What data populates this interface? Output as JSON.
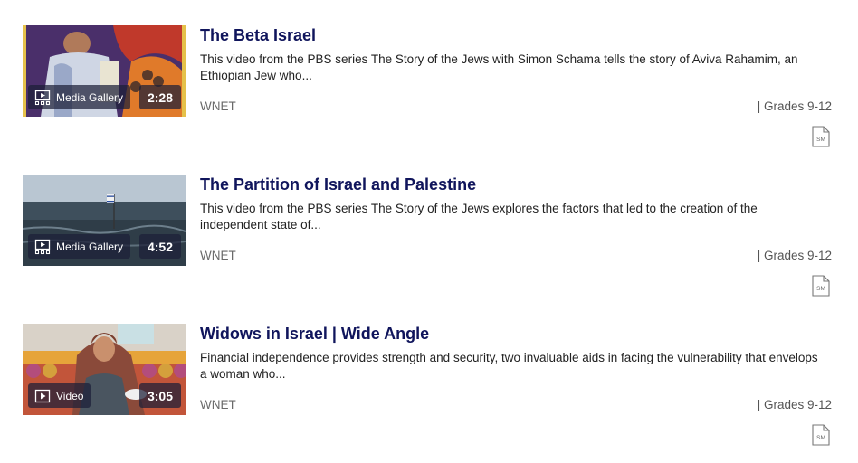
{
  "results": [
    {
      "title": "The Beta Israel",
      "description": "This video from the PBS series The Story of the Jews with Simon Schama tells the story of Aviva Rahamim, an Ethiopian Jew who...",
      "media_type": "Media Gallery",
      "duration": "2:28",
      "producer": "WNET",
      "grades": "| Grades 9-12",
      "standards_icon": "SM"
    },
    {
      "title": "The Partition of Israel and Palestine",
      "description": "This video from the PBS series The Story of the Jews explores the factors that led to the creation of the independent state of...",
      "media_type": "Media Gallery",
      "duration": "4:52",
      "producer": "WNET",
      "grades": "| Grades 9-12",
      "standards_icon": "SM"
    },
    {
      "title": "Widows in Israel | Wide Angle",
      "description": "Financial independence provides strength and security, two invaluable aids in facing the vulnerability that envelops a woman who...",
      "media_type": "Video",
      "duration": "3:05",
      "producer": "WNET",
      "grades": "| Grades 9-12",
      "standards_icon": "SM"
    }
  ],
  "colors": {
    "title": "#10155c",
    "badge_bg": "#1c1e37"
  }
}
